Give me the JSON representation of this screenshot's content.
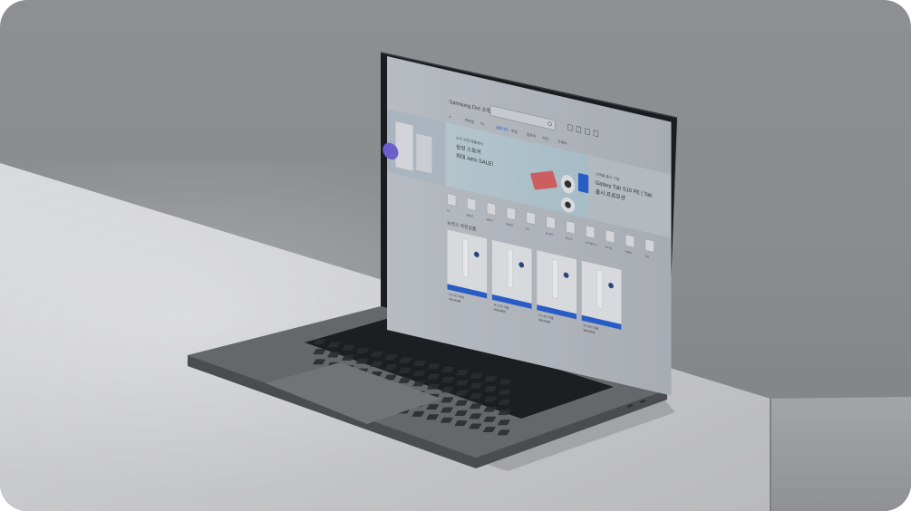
{
  "scene": {
    "colors": {
      "wall": "#8b8d91",
      "desk": "#c9cacd",
      "laptop_body": "#5f6165",
      "bezel": "#1e1f22",
      "keys": "#1c1d20",
      "accent": "#1a57d6"
    }
  },
  "screen": {
    "brand": "Samsung Dot 쇼핑",
    "search_icon": "search-icon",
    "header_icons": [
      "user-icon",
      "heart-icon",
      "cart-icon",
      "menu-icon"
    ],
    "nav_items": [
      "≡",
      "모바일",
      "TV",
      "생활가전",
      "주방",
      "컴퓨터",
      "가전",
      "카메라"
    ],
    "hero_left": {
      "kicker": "오직 가전 제품에서",
      "title": "삼성 스토어",
      "subtitle": "최대 44% SALE!"
    },
    "hero_right": {
      "kicker": "신제품 출시 기념",
      "title": "Galaxy Tab S10 FE | Tab",
      "subtitle": "출시 프로모션"
    },
    "section_title": "뉴진스 추천상품",
    "categories": [
      {
        "label": "TV",
        "icon": "tv-icon"
      },
      {
        "label": "냉장고",
        "icon": "fridge-icon"
      },
      {
        "label": "세탁기",
        "icon": "washer-icon"
      },
      {
        "label": "에어컨",
        "icon": "aircon-icon"
      },
      {
        "label": "PC",
        "icon": "pc-icon"
      },
      {
        "label": "모니터",
        "icon": "monitor-icon"
      },
      {
        "label": "청소기",
        "icon": "vacuum-icon"
      },
      {
        "label": "식기세척기",
        "icon": "dishwasher-icon"
      },
      {
        "label": "오디오",
        "icon": "audio-icon"
      },
      {
        "label": "카메라",
        "icon": "camera-icon"
      },
      {
        "label": "기타",
        "icon": "etc-icon"
      }
    ],
    "products": [
      {
        "name": "비스포크 제품",
        "price": "999,000원"
      },
      {
        "name": "비스포크 제품",
        "price": "999,000원"
      },
      {
        "name": "비스포크 제품",
        "price": "999,000원"
      },
      {
        "name": "비스포크 제품",
        "price": "999,000원"
      }
    ]
  }
}
